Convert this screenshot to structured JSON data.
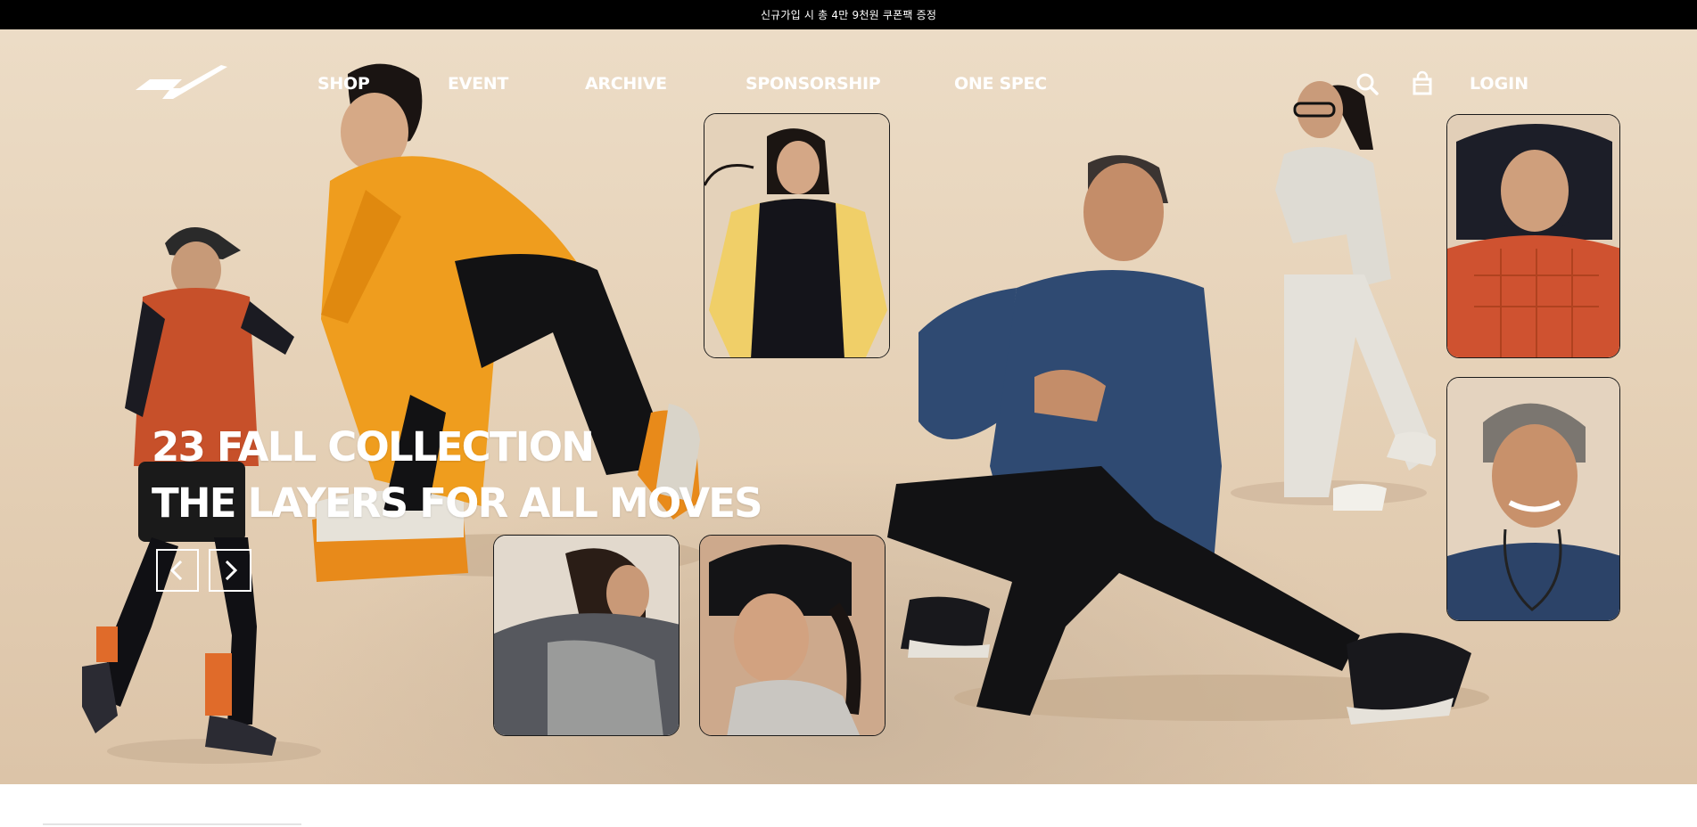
{
  "announcement": {
    "text": "신규가입 시 총 4만 9천원 쿠폰팩 증정"
  },
  "header": {
    "logo_icon": "brand-wing-logo",
    "nav": [
      {
        "label": "SHOP"
      },
      {
        "label": "EVENT"
      },
      {
        "label": "ARCHIVE"
      },
      {
        "label": "SPONSORSHIP"
      },
      {
        "label": "ONE SPEC"
      }
    ],
    "search_icon": "search-icon",
    "cart_icon": "shopping-bag-icon",
    "login_label": "LOGIN"
  },
  "hero": {
    "headline_line1": "23 FALL COLLECTION",
    "headline_line2": "THE LAYERS FOR ALL MOVES",
    "prev_icon": "chevron-left-icon",
    "next_icon": "chevron-right-icon"
  },
  "colors": {
    "announcement_bg": "#000000",
    "hero_bg": "#e6d2b8",
    "text_on_hero": "#ffffff",
    "card_border": "#1a1a1a"
  }
}
